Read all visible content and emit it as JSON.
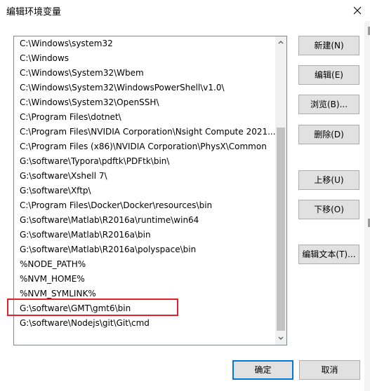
{
  "window": {
    "title": "编辑环境变量"
  },
  "list": {
    "items": [
      "C:\\Windows\\system32",
      "C:\\Windows",
      "C:\\Windows\\System32\\Wbem",
      "C:\\Windows\\System32\\WindowsPowerShell\\v1.0\\",
      "C:\\Windows\\System32\\OpenSSH\\",
      "C:\\Program Files\\dotnet\\",
      "C:\\Program Files\\NVIDIA Corporation\\Nsight Compute 2021....",
      "C:\\Program Files (x86)\\NVIDIA Corporation\\PhysX\\Common",
      "G:\\software\\Typora\\pdftk\\PDFtk\\bin\\",
      "G:\\software\\Xshell 7\\",
      "G:\\software\\Xftp\\",
      "C:\\Program Files\\Docker\\Docker\\resources\\bin",
      "G:\\software\\Matlab\\R2016a\\runtime\\win64",
      "G:\\software\\Matlab\\R2016a\\bin",
      "G:\\software\\Matlab\\R2016a\\polyspace\\bin",
      "%NODE_PATH%",
      "%NVM_HOME%",
      "%NVM_SYMLINK%",
      "G:\\software\\GMT\\gmt6\\bin",
      "G:\\software\\Nodejs\\git\\Git\\cmd"
    ]
  },
  "buttons": {
    "new": "新建(N)",
    "edit": "编辑(E)",
    "browse": "浏览(B)...",
    "delete": "删除(D)",
    "move_up": "上移(U)",
    "move_down": "下移(O)",
    "edit_text": "编辑文本(T)...",
    "ok": "确定",
    "cancel": "取消"
  },
  "icons": {
    "close": "close-icon",
    "scroll_up": "chevron-up-icon",
    "scroll_down": "chevron-down-icon"
  },
  "colors": {
    "highlight_border": "#e0202a",
    "primary_button_border": "#0078d7",
    "button_face": "#e1e1e1"
  }
}
